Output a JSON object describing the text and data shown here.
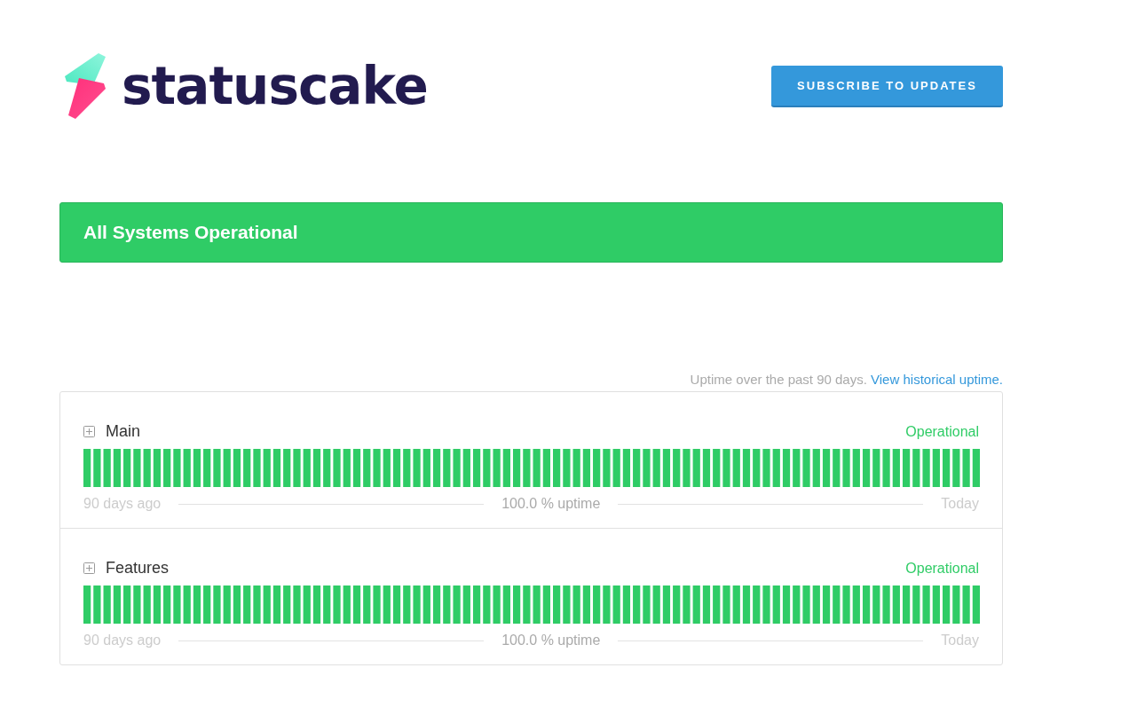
{
  "logo": {
    "text": "statuscake"
  },
  "subscribe_button": "SUBSCRIBE TO UPDATES",
  "banner": "All Systems Operational",
  "uptime_note": {
    "text": "Uptime over the past 90 days.",
    "link": "View historical uptime."
  },
  "components": [
    {
      "name": "Main",
      "expanded": false,
      "status": "Operational",
      "start": "90 days ago",
      "uptime": "100.0 % uptime",
      "end": "Today"
    },
    {
      "name": "Features",
      "expanded": false,
      "status": "Operational",
      "start": "90 days ago",
      "uptime": "100.0 % uptime",
      "end": "Today"
    }
  ]
}
